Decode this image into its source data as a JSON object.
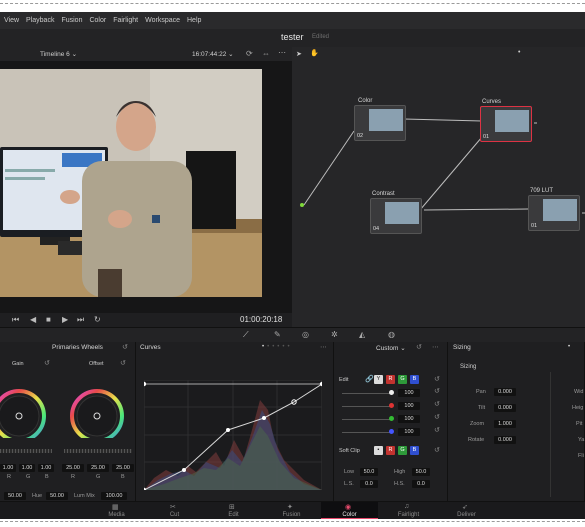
{
  "menubar": {
    "items": [
      "View",
      "Playback",
      "Fusion",
      "Color",
      "Fairlight",
      "Workspace",
      "Help"
    ]
  },
  "project": {
    "title": "tester",
    "status": "Edited"
  },
  "viewer": {
    "timeline": "Timeline 6",
    "timecode": "16:07:44:22",
    "playhead": "01:00:20:18"
  },
  "nodes": [
    {
      "label": "Color",
      "num": "02"
    },
    {
      "label": "Curves",
      "num": "01"
    },
    {
      "label": "Contrast",
      "num": "04"
    },
    {
      "label": "709 LUT",
      "num": "01"
    }
  ],
  "primaries": {
    "title": "Primaries Wheels",
    "gain": {
      "label": "Gain",
      "values": [
        "1.00",
        "1.00",
        "1.00"
      ],
      "channels": [
        "R",
        "G",
        "B"
      ]
    },
    "offset": {
      "label": "Offset",
      "values": [
        "25.00",
        "25.00",
        "25.00"
      ],
      "channels": [
        "R",
        "G",
        "B"
      ]
    },
    "bottom": {
      "val1": "50.00",
      "hue_label": "Hue",
      "hue": "50.00",
      "lummix_label": "Lum Mix",
      "lummix": "100.00"
    }
  },
  "curves": {
    "title": "Curves"
  },
  "custom": {
    "title": "Custom",
    "edit_label": "Edit",
    "channel_buttons": [
      "Y",
      "R",
      "G",
      "B"
    ],
    "rows": [
      "100",
      "100",
      "100",
      "100"
    ],
    "softclip_label": "Soft Clip",
    "low_label": "Low",
    "low": "50.0",
    "high_label": "High",
    "high": "50.0",
    "ls_label": "L.S.",
    "ls": "0.0",
    "hs_label": "H.S.",
    "hs": "0.0"
  },
  "sizing": {
    "title": "Sizing",
    "sub": "Sizing",
    "fields": [
      {
        "label": "Pan",
        "value": "0.000"
      },
      {
        "label": "Tilt",
        "value": "0.000"
      },
      {
        "label": "Zoom",
        "value": "1.000"
      },
      {
        "label": "Rotate",
        "value": "0.000"
      }
    ],
    "right_labels": [
      "Wid",
      "Heig",
      "Pit",
      "Ya",
      "Fli"
    ]
  },
  "pages": [
    {
      "label": "Media",
      "icon": "▦"
    },
    {
      "label": "Cut",
      "icon": "✂"
    },
    {
      "label": "Edit",
      "icon": "⊞"
    },
    {
      "label": "Fusion",
      "icon": "✦"
    },
    {
      "label": "Color",
      "icon": "◉"
    },
    {
      "label": "Fairlight",
      "icon": "♫"
    },
    {
      "label": "Deliver",
      "icon": "➶"
    }
  ]
}
